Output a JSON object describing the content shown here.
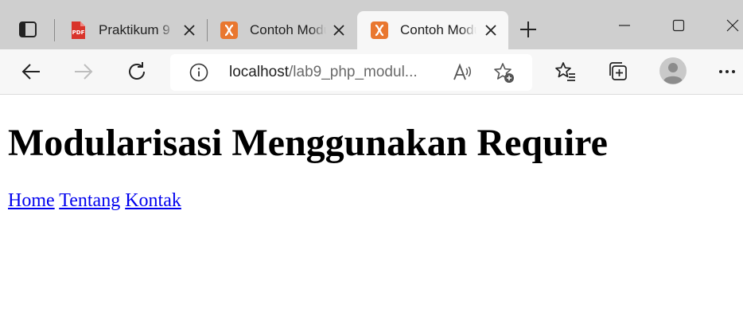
{
  "tabs": [
    {
      "title": "Praktikum 9",
      "favicon": "pdf-icon",
      "active": false
    },
    {
      "title": "Contoh Modularisasi",
      "favicon": "xampp-icon",
      "active": false
    },
    {
      "title": "Contoh Modularisasi",
      "favicon": "xampp-icon",
      "active": true
    }
  ],
  "address": {
    "host": "localhost",
    "path": "/lab9_php_modul..."
  },
  "page": {
    "title": "Modularisasi Menggunakan Require",
    "nav": [
      "Home",
      "Tentang",
      "Kontak"
    ]
  },
  "colors": {
    "tabstrip": "#cfcfcf",
    "toolbar": "#f7f7f7",
    "link": "#0000ee",
    "xampp_orange": "#e9772f",
    "pdf_red": "#d9342b"
  }
}
